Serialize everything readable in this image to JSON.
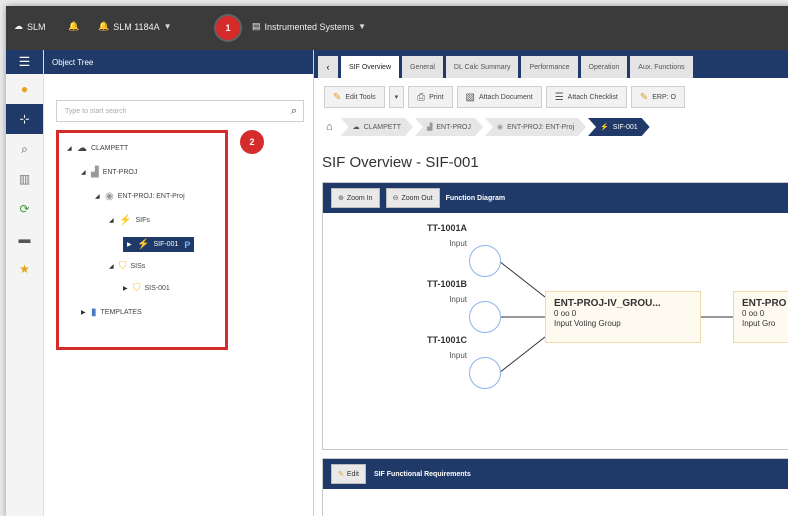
{
  "topbar": {
    "app": "SLM",
    "site": "SLM 1184A",
    "context": "Instrumented Systems",
    "callout_1": "1",
    "callout_2": "2"
  },
  "tree_panel": {
    "title": "Object Tree",
    "search_placeholder": "Type to start search",
    "nodes": [
      {
        "label": "CLAMPETT"
      },
      {
        "label": "ENT-PROJ"
      },
      {
        "label": "ENT-PROJ: ENT-Proj"
      },
      {
        "label": "SIFs"
      },
      {
        "label": "SIF-001",
        "flag": "P"
      },
      {
        "label": "SISs"
      },
      {
        "label": "SIS-001"
      },
      {
        "label": "TEMPLATES"
      }
    ]
  },
  "tabs": [
    "SIF Overview",
    "General",
    "DL Calc Summary",
    "Performance",
    "Operation",
    "Aux. Functions"
  ],
  "toolbar": {
    "edit_tools": "Edit Tools",
    "print": "Print",
    "attach_document": "Attach Document",
    "attach_checklist": "Attach Checklist",
    "erp": "ERP: O"
  },
  "breadcrumb": [
    "CLAMPETT",
    "ENT-PROJ",
    "ENT-PROJ: ENT-Proj",
    "SIF-001"
  ],
  "page_title": "SIF Overview - SIF-001",
  "diagram": {
    "zoom_in": "Zoom In",
    "zoom_out": "Zoom Out",
    "label": "Function Diagram",
    "inputs": [
      {
        "name": "TT-1001A",
        "type": "Input"
      },
      {
        "name": "TT-1001B",
        "type": "Input"
      },
      {
        "name": "TT-1001C",
        "type": "Input"
      }
    ],
    "groups": [
      {
        "name": "ENT-PROJ-IV_GROU...",
        "value": "0 oo 0",
        "type": "Input Voting Group"
      },
      {
        "name": "ENT-PRO",
        "value": "0 oo 0",
        "type": "Input Gro"
      }
    ]
  },
  "requirements": {
    "edit": "Edit",
    "label": "SIF Functional Requirements"
  }
}
